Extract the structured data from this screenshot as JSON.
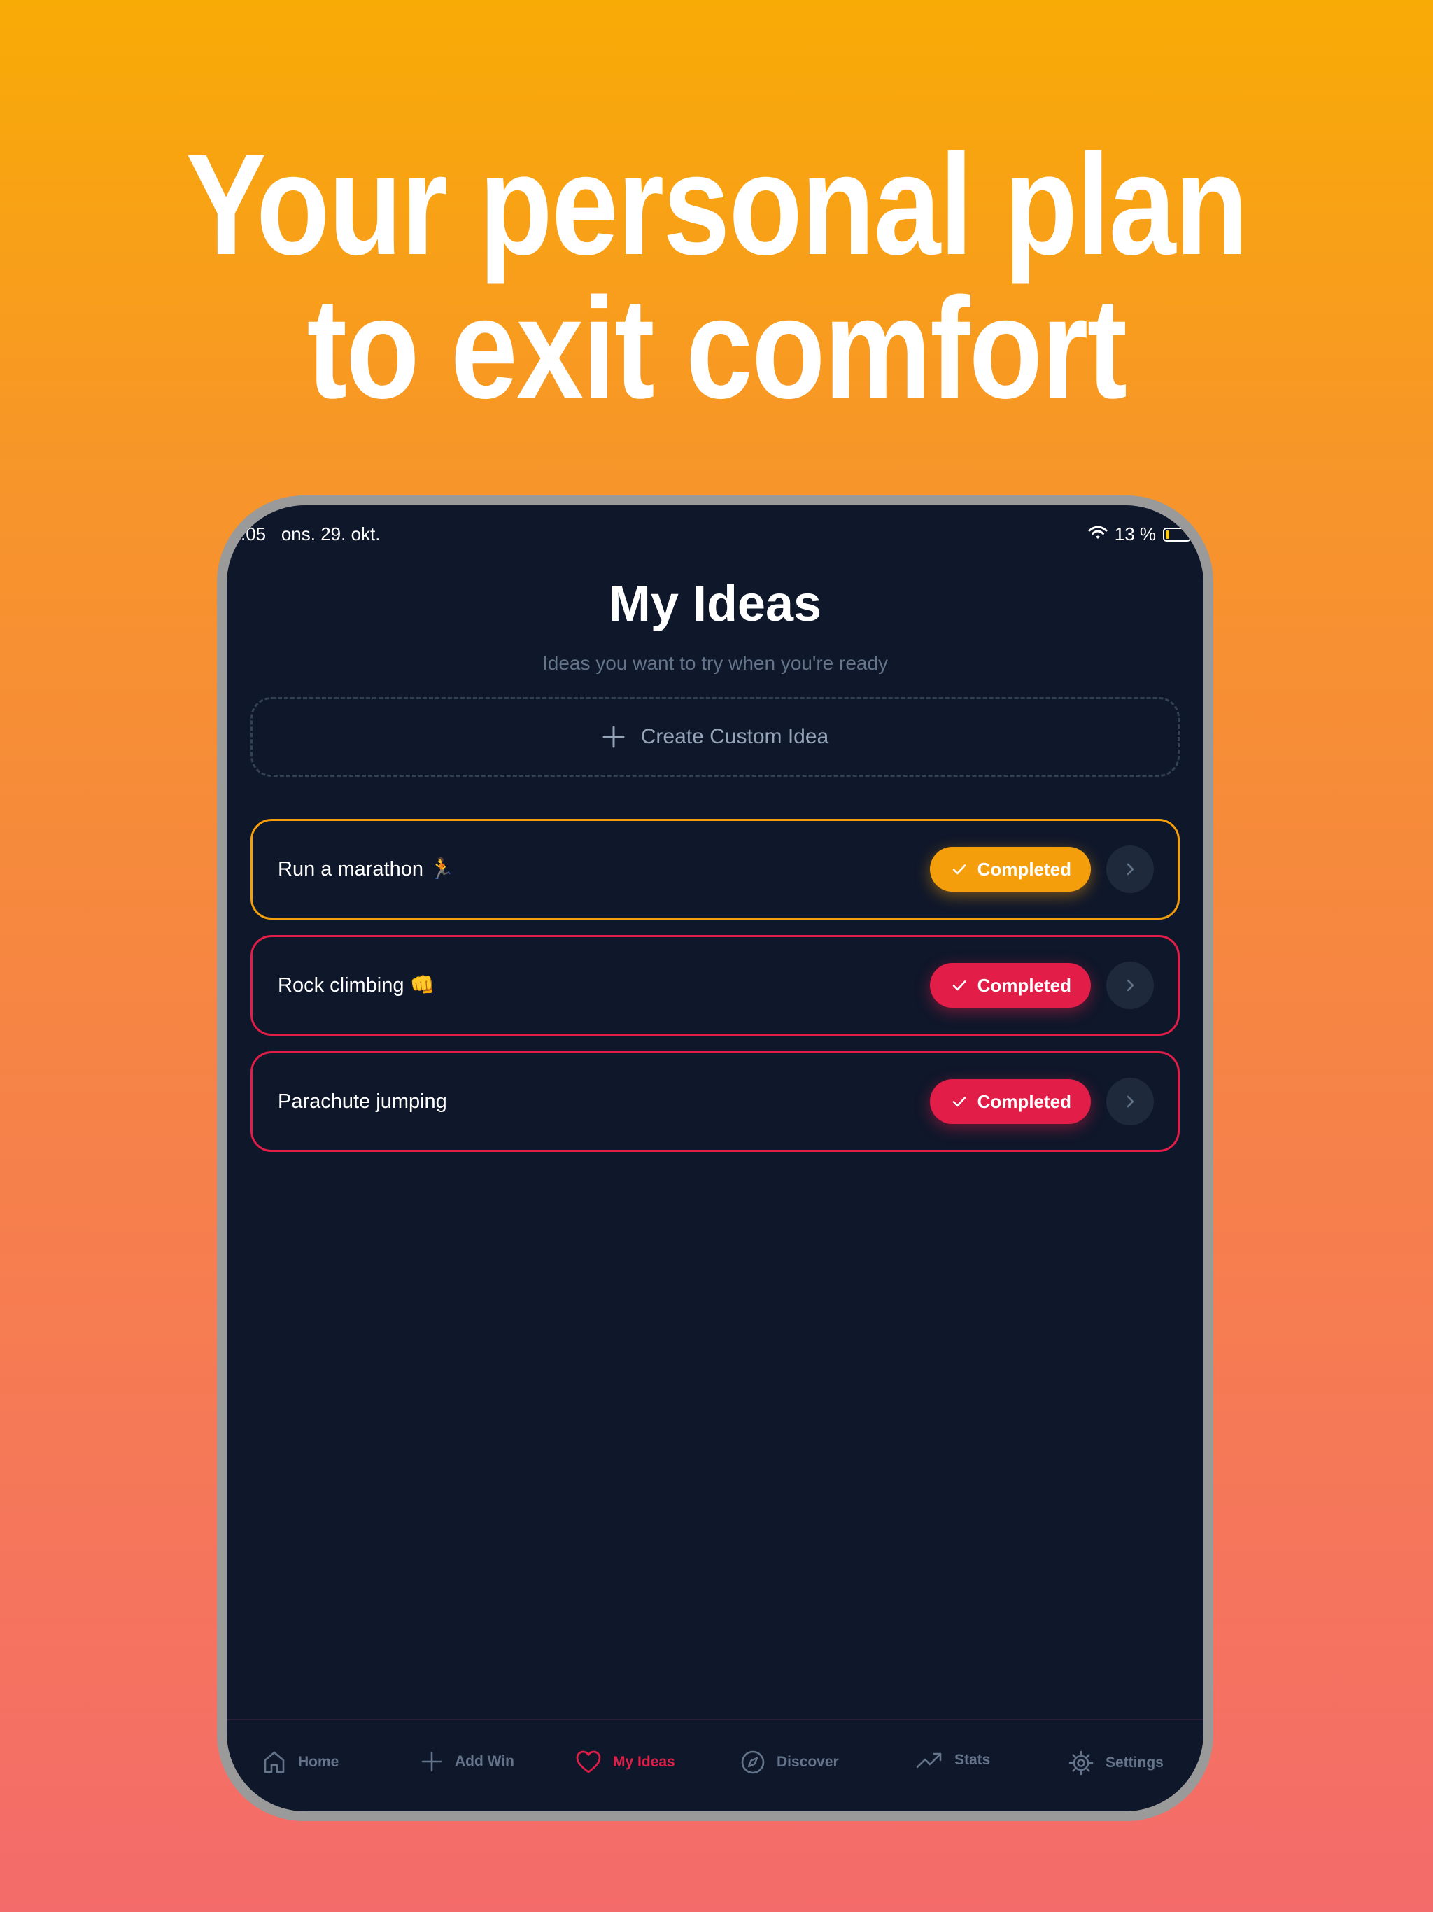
{
  "headline": {
    "line1": "Your personal plan",
    "line2": "to exit comfort"
  },
  "status_bar": {
    "time": ".05",
    "date": "ons. 29. okt.",
    "battery": "13 %",
    "battery_level": 0.13
  },
  "page": {
    "title": "My Ideas",
    "subtitle": "Ideas you want to try when you're ready"
  },
  "create_button": {
    "label": "Create Custom Idea",
    "icon": "plus-icon"
  },
  "ideas": [
    {
      "label": "Run a marathon 🏃",
      "status": "Completed",
      "color": "#f59e0b"
    },
    {
      "label": "Rock climbing 👊",
      "status": "Completed",
      "color": "#e11d48"
    },
    {
      "label": "Parachute jumping",
      "status": "Completed",
      "color": "#e11d48"
    }
  ],
  "tabs": [
    {
      "label": "Home",
      "icon": "home-icon"
    },
    {
      "label": "Add Win",
      "icon": "plus-icon"
    },
    {
      "label": "My Ideas",
      "icon": "heart-icon",
      "active": true
    },
    {
      "label": "Discover",
      "icon": "compass-icon"
    },
    {
      "label": "Stats",
      "icon": "trending-up-icon"
    },
    {
      "label": "Settings",
      "icon": "gear-icon"
    }
  ],
  "colors": {
    "background_top": "#f9ab05",
    "background_bottom": "#f46b6b",
    "screen": "#0f172a",
    "accent_red": "#e11d48",
    "accent_orange": "#f59e0b",
    "muted": "#64748b"
  }
}
